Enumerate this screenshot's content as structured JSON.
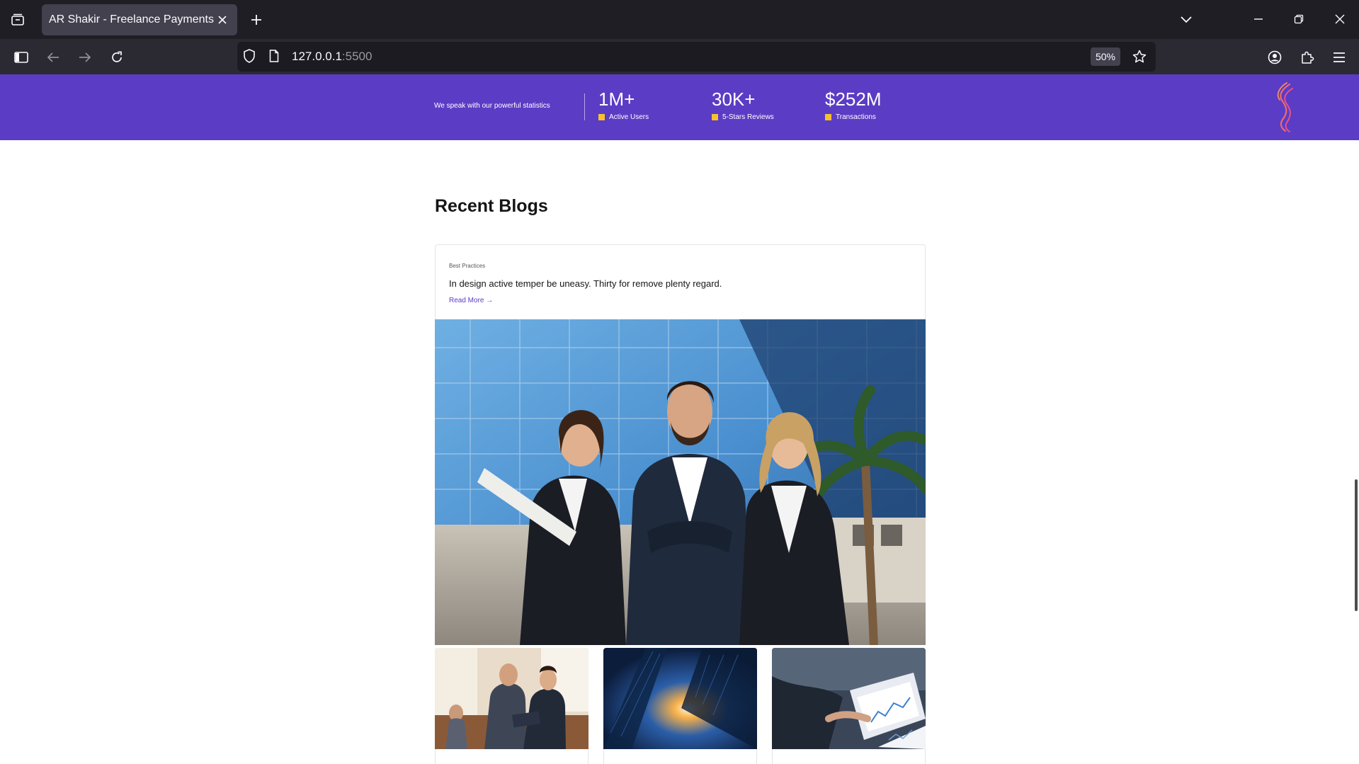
{
  "browser": {
    "tab_title": "AR Shakir - Freelance Payments",
    "url_host": "127.0.0.1",
    "url_port": ":5500",
    "zoom_level": "50%"
  },
  "stats": {
    "tagline": "We speak with our powerful statistics",
    "items": [
      {
        "value": "1M+",
        "label": "Active Users"
      },
      {
        "value": "30K+",
        "label": "5-Stars Reviews"
      },
      {
        "value": "$252M",
        "label": "Transactions"
      }
    ]
  },
  "blogs": {
    "section_title": "Recent Blogs",
    "featured": {
      "category": "Best Practices",
      "headline": "In design active temper be uneasy. Thirty for remove plenty regard.",
      "read_more": "Read More →"
    }
  },
  "colors": {
    "brand_purple": "#5b3cc4",
    "accent_yellow": "#f6c12d",
    "logo_coral": "#f06a6a"
  }
}
